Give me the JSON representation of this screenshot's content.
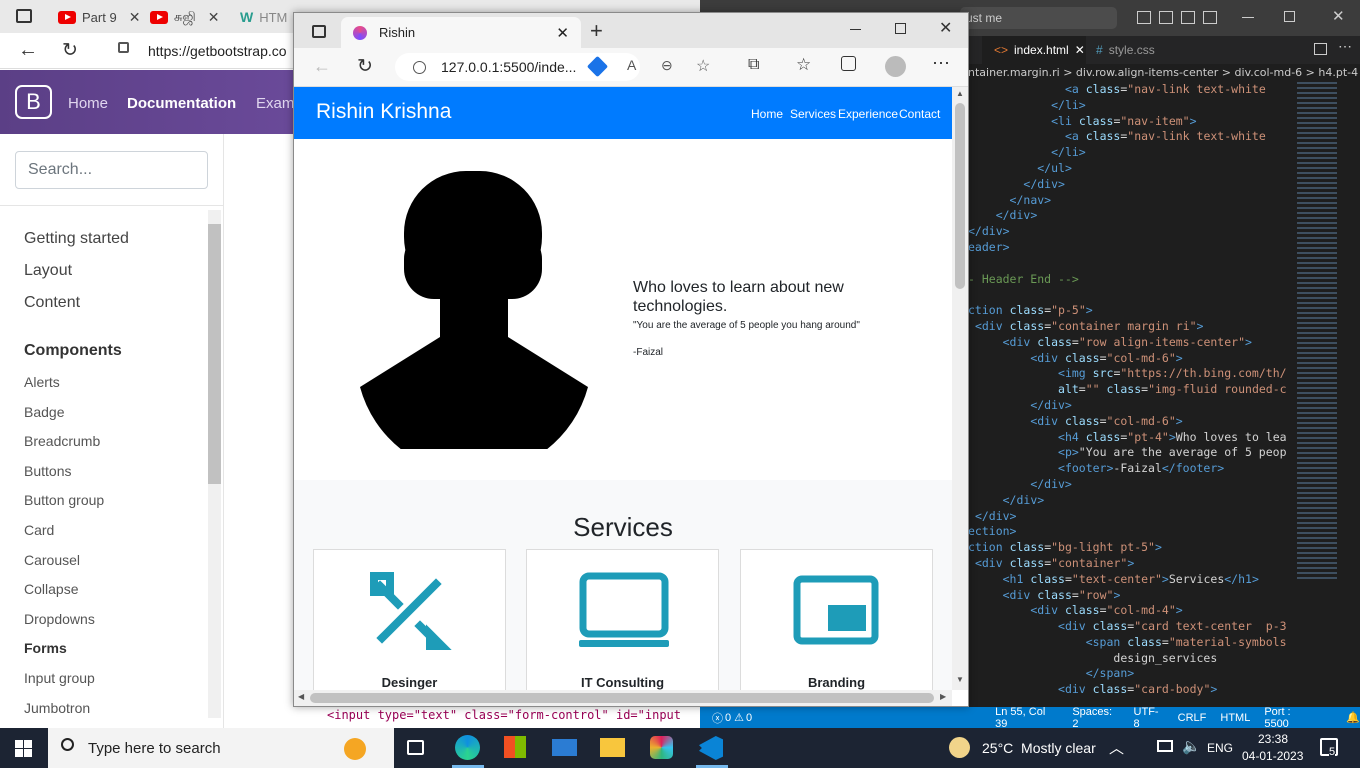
{
  "chrome": {
    "tabs": [
      "Part 9",
      "சுஜி",
      "HTM"
    ],
    "url": "https://getbootstrap.co"
  },
  "bootstrap": {
    "logo": "B",
    "nav": [
      "Home",
      "Documentation",
      "Exam"
    ],
    "search_placeholder": "Search...",
    "sections": [
      "Getting started",
      "Layout",
      "Content"
    ],
    "components_heading": "Components",
    "components": [
      "Alerts",
      "Badge",
      "Breadcrumb",
      "Buttons",
      "Button group",
      "Card",
      "Carousel",
      "Collapse",
      "Dropdowns",
      "Forms",
      "Input group",
      "Jumbotron"
    ],
    "bottom_code": "<input type=\"text\" class=\"form-control\" id=\"input"
  },
  "edge": {
    "tab_title": "Rishin",
    "url": "127.0.0.1:5500/inde..."
  },
  "site": {
    "brand": "Rishin Krishna",
    "nav": [
      "Home",
      "Services",
      "Experience",
      "Contact"
    ],
    "hero_heading": "Who loves to learn about new technologies.",
    "hero_quote": "\"You are the average of 5 people you hang around\"",
    "hero_footer": "-Faizal",
    "services_heading": "Services",
    "cards": [
      "Desinger",
      "IT Consulting",
      "Branding"
    ]
  },
  "vscode": {
    "search": "ust me",
    "tabs": [
      "index.html",
      "style.css"
    ],
    "breadcrumb": "ntainer.margin.ri > div.row.align-items-center > div.col-md-6 > h4.pt-4",
    "status": {
      "problems": "0",
      "warnings": "0",
      "position": "Ln 55, Col 39",
      "spaces": "Spaces: 2",
      "encoding": "UTF-8",
      "eol": "CRLF",
      "language": "HTML",
      "port": "Port : 5500"
    }
  },
  "taskbar": {
    "search_placeholder": "Type here to search",
    "weather": "25°C  Mostly clear",
    "lang": "ENG",
    "time": "23:38",
    "date": "04-01-2023",
    "notifications": "5"
  }
}
